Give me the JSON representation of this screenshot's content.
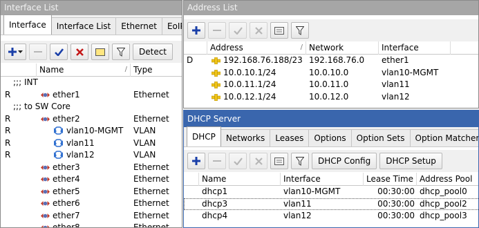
{
  "interface_window": {
    "title": "Interface List",
    "tabs": [
      "Interface",
      "Interface List",
      "Ethernet",
      "EoIP"
    ],
    "toolbar": {
      "detect_label": "Detect"
    },
    "columns": [
      "Name",
      "Type"
    ],
    "rows": [
      {
        "kind": "comment",
        "text": ";;; INT"
      },
      {
        "flag": "R",
        "name": "ether1",
        "type": "Ethernet",
        "icon": "ethernet-port-icon",
        "indent": 0
      },
      {
        "kind": "comment",
        "text": ";;; to SW Core"
      },
      {
        "flag": "R",
        "name": "ether2",
        "type": "Ethernet",
        "icon": "ethernet-port-icon",
        "indent": 0
      },
      {
        "flag": "R",
        "name": "vlan10-MGMT",
        "type": "VLAN",
        "icon": "vlan-icon",
        "indent": 1
      },
      {
        "flag": "R",
        "name": "vlan11",
        "type": "VLAN",
        "icon": "vlan-icon",
        "indent": 1
      },
      {
        "flag": "R",
        "name": "vlan12",
        "type": "VLAN",
        "icon": "vlan-icon",
        "indent": 1
      },
      {
        "flag": "",
        "name": "ether3",
        "type": "Ethernet",
        "icon": "ethernet-port-icon",
        "indent": 0
      },
      {
        "flag": "",
        "name": "ether4",
        "type": "Ethernet",
        "icon": "ethernet-port-icon",
        "indent": 0
      },
      {
        "flag": "",
        "name": "ether5",
        "type": "Ethernet",
        "icon": "ethernet-port-icon",
        "indent": 0
      },
      {
        "flag": "",
        "name": "ether6",
        "type": "Ethernet",
        "icon": "ethernet-port-icon",
        "indent": 0
      },
      {
        "flag": "",
        "name": "ether7",
        "type": "Ethernet",
        "icon": "ethernet-port-icon",
        "indent": 0
      },
      {
        "flag": "",
        "name": "ether8",
        "type": "Ethernet",
        "icon": "ethernet-port-icon",
        "indent": 0
      }
    ]
  },
  "address_window": {
    "title": "Address List",
    "columns": [
      "Address",
      "Network",
      "Interface"
    ],
    "rows": [
      {
        "flag": "D",
        "address": "192.168.76.188/23",
        "network": "192.168.76.0",
        "interface": "ether1"
      },
      {
        "flag": "",
        "address": "10.0.10.1/24",
        "network": "10.0.10.0",
        "interface": "vlan10-MGMT"
      },
      {
        "flag": "",
        "address": "10.0.11.1/24",
        "network": "10.0.11.0",
        "interface": "vlan11"
      },
      {
        "flag": "",
        "address": "10.0.12.1/24",
        "network": "10.0.12.0",
        "interface": "vlan12"
      }
    ]
  },
  "dhcp_window": {
    "title": "DHCP Server",
    "tabs": [
      "DHCP",
      "Networks",
      "Leases",
      "Options",
      "Option Sets",
      "Option Matcher"
    ],
    "toolbar": {
      "config_label": "DHCP Config",
      "setup_label": "DHCP Setup"
    },
    "columns": [
      "Name",
      "Interface",
      "Lease Time",
      "Address Pool"
    ],
    "rows": [
      {
        "name": "dhcp1",
        "interface": "vlan10-MGMT",
        "lease_time": "00:30:00",
        "pool": "dhcp_pool0"
      },
      {
        "name": "dhcp3",
        "interface": "vlan11",
        "lease_time": "00:30:00",
        "pool": "dhcp_pool2"
      },
      {
        "name": "dhcp4",
        "interface": "vlan12",
        "lease_time": "00:30:00",
        "pool": "dhcp_pool3"
      }
    ]
  },
  "colors": {
    "accent_blue": "#3a66ad",
    "add_blue": "#1a3fa8",
    "remove_red": "#c41818",
    "check_blue": "#1a3fa8",
    "address_yellow": "#f0c419"
  }
}
